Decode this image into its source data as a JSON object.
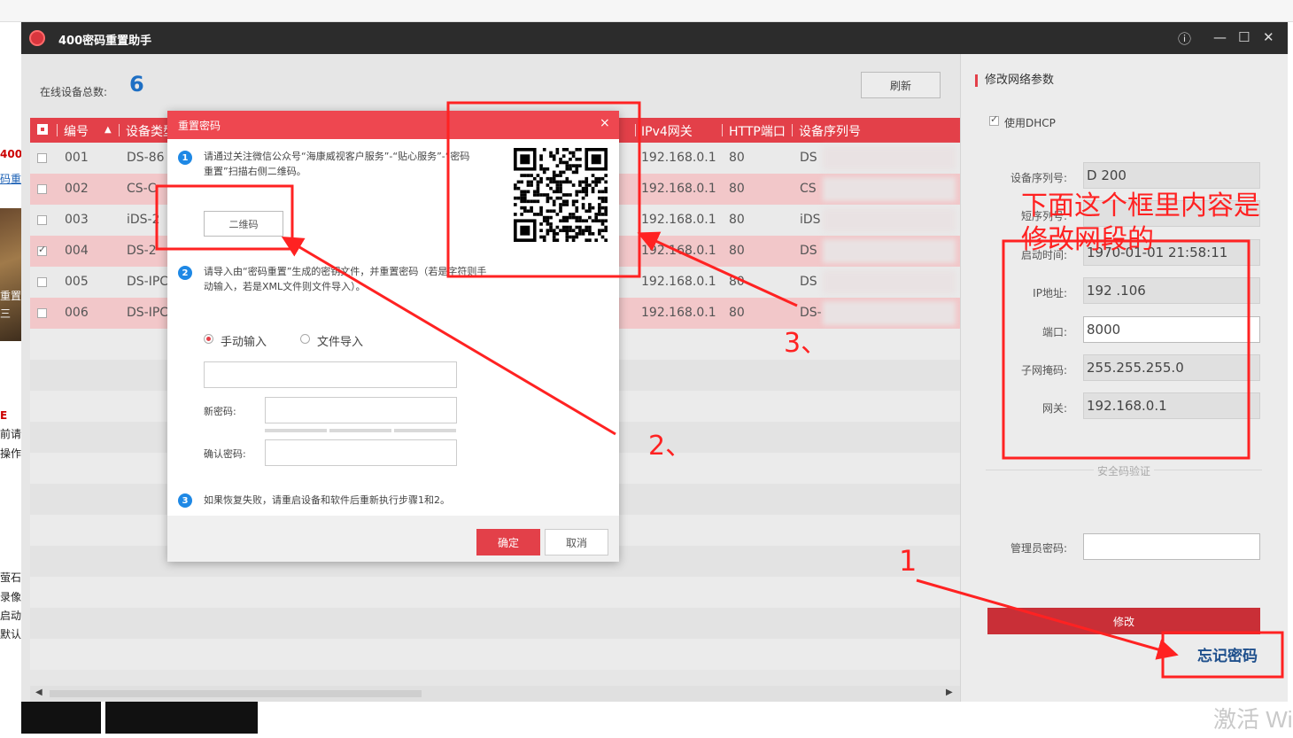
{
  "app": {
    "title": "400密码重置助手",
    "controls": {
      "info": "ⓘ",
      "minimize": "—",
      "maximize": "☐",
      "close": "✕"
    }
  },
  "device_list": {
    "count_label": "在线设备总数:",
    "count_value": "6",
    "refresh_label": "刷新",
    "columns": [
      "编号",
      "设备类型",
      "IPv4网关",
      "HTTP端口",
      "设备序列号"
    ],
    "rows": [
      {
        "no": "001",
        "type": "DS-86",
        "gateway": "192.168.0.1",
        "port": "80",
        "serial": "DS",
        "checked": false
      },
      {
        "no": "002",
        "type": "CS-C",
        "gateway": "192.168.0.1",
        "port": "80",
        "serial": "CS",
        "checked": false
      },
      {
        "no": "003",
        "type": "iDS-2",
        "gateway": "192.168.0.1",
        "port": "80",
        "serial": "iDS",
        "checked": false
      },
      {
        "no": "004",
        "type": "DS-2",
        "gateway": "192.168.0.1",
        "port": "80",
        "serial": "DS",
        "checked": true
      },
      {
        "no": "005",
        "type": "DS-IPC",
        "gateway": "192.168.0.1",
        "port": "80",
        "serial": "DS",
        "checked": false
      },
      {
        "no": "006",
        "type": "DS-IPC",
        "gateway": "192.168.0.1",
        "port": "80",
        "serial": "DS-",
        "checked": false
      }
    ]
  },
  "network_panel": {
    "title": "修改网络参数",
    "dhcp_label": "使用DHCP",
    "fields": [
      {
        "label": "设备序列号:",
        "value": "D                    200"
      },
      {
        "label": "短序列号:",
        "value": ""
      },
      {
        "label": "启动时间:",
        "value": "1970-01-01 21:58:11"
      },
      {
        "label": "IP地址:",
        "value": "192        .106"
      },
      {
        "label": "端口:",
        "value": "8000"
      },
      {
        "label": "子网掩码:",
        "value": "255.255.255.0"
      },
      {
        "label": "网关:",
        "value": "192.168.0.1"
      }
    ],
    "safe_code_label": "安全码验证",
    "admin_password_label": "管理员密码:",
    "modify_label": "修改",
    "forgot_label": "忘记密码"
  },
  "dialog": {
    "title": "重置密码",
    "close": "×",
    "step1": "请通过关注微信公众号“海康威视客户服务”-“贴心服务”-“密码重置”扫描右侧二维码。",
    "qr_button": "二维码",
    "step2": "请导入由“密码重置”生成的密钥文件，并重置密码（若是字符则手动输入，若是XML文件则文件导入）。",
    "manual_label": "手动输入",
    "file_label": "文件导入",
    "new_password_label": "新密码:",
    "confirm_password_label": "确认密码:",
    "step3": "如果恢复失败，请重启设备和软件后重新执行步骤1和2。",
    "ok_label": "确定",
    "cancel_label": "取消"
  },
  "annotations": {
    "note": "下面这个框里内容是修改网段的",
    "step1": "1",
    "step2": "2、",
    "step3": "3、",
    "color": "#ff2222"
  },
  "background": {
    "left_fragments": [
      "400",
      "码重置",
      "重置",
      "三",
      "E",
      "前请",
      "操作",
      "萤石",
      "录像",
      "启动",
      "默认"
    ],
    "taskbar_text": "激活 Wi"
  },
  "colors": {
    "accent": "#e34049",
    "title_bar": "#2c2c2c",
    "link": "#1e4f8c"
  }
}
